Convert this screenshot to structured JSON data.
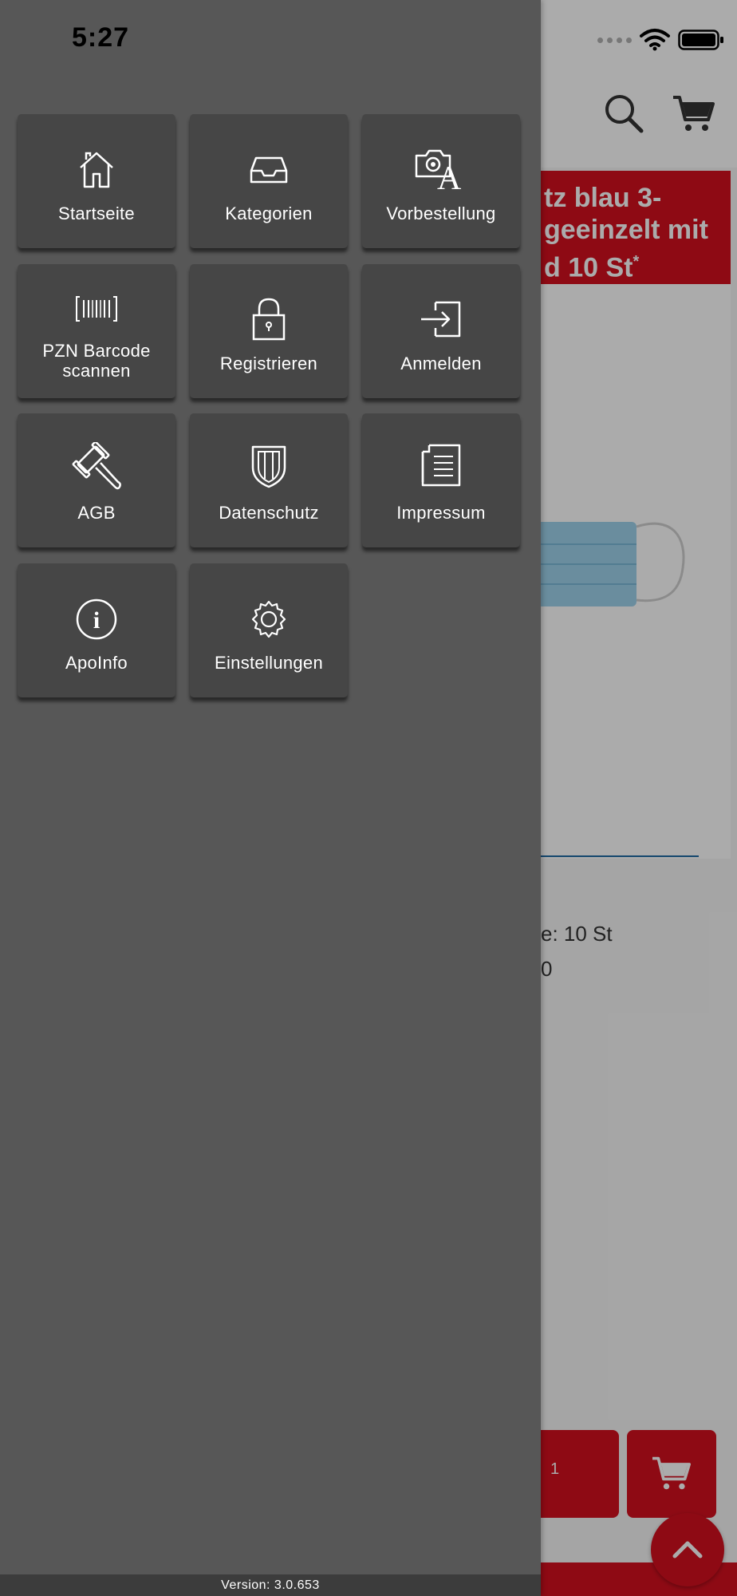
{
  "status_bar": {
    "time": "5:27"
  },
  "drawer": {
    "items": [
      {
        "label": "Startseite",
        "icon": "home-icon"
      },
      {
        "label": "Kategorien",
        "icon": "inbox-icon"
      },
      {
        "label": "Vorbestellung",
        "icon": "camera-prescription-icon"
      },
      {
        "label": "PZN Barcode scannen",
        "icon": "barcode-icon"
      },
      {
        "label": "Registrieren",
        "icon": "lock-icon"
      },
      {
        "label": "Anmelden",
        "icon": "login-icon"
      },
      {
        "label": "AGB",
        "icon": "gavel-icon"
      },
      {
        "label": "Datenschutz",
        "icon": "shield-icon"
      },
      {
        "label": "Impressum",
        "icon": "document-icon"
      },
      {
        "label": "ApoInfo",
        "icon": "info-icon"
      },
      {
        "label": "Einstellungen",
        "icon": "gear-icon"
      }
    ],
    "version": "Version: 3.0.653"
  },
  "background_page": {
    "title_lines": [
      "tz blau 3-",
      "geeinzelt mit",
      "d 10 St"
    ],
    "title_footnote": "*",
    "info_lines": [
      "e: 10 St",
      "0"
    ],
    "qty_label": "1",
    "colors": {
      "accent": "#d4101f",
      "link_underline": "#1f6aa5",
      "drawer_bg": "#575757",
      "tile_bg": "#464646"
    }
  }
}
